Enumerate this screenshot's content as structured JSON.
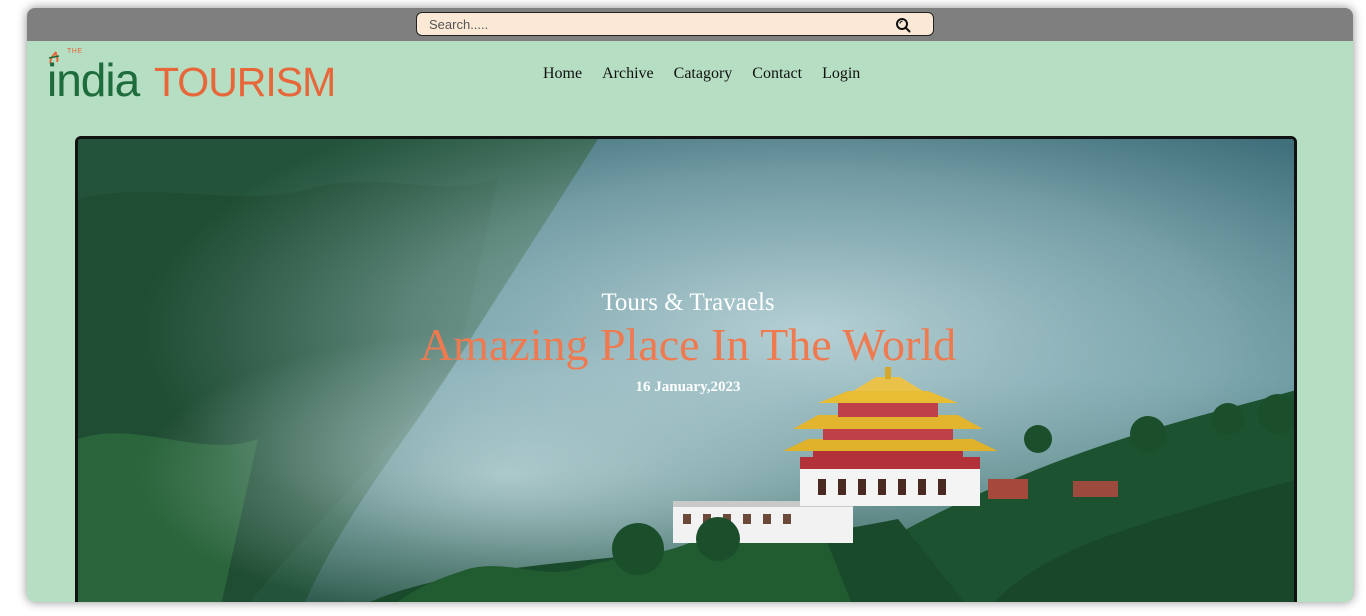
{
  "search": {
    "placeholder": "Search....."
  },
  "logo": {
    "the": "THE",
    "india": "india",
    "tourism": "TOURISM"
  },
  "nav": {
    "items": [
      "Home",
      "Archive",
      "Catagory",
      "Contact",
      "Login"
    ]
  },
  "hero": {
    "subtitle": "Tours & Travaels",
    "title": "Amazing Place In The World",
    "date": "16 January,2023"
  },
  "colors": {
    "page_bg": "#b5dec2",
    "topbar": "#7f7f7f",
    "search_bg": "#fbe9d6",
    "brand_green": "#1e6b3c",
    "brand_orange": "#e8673a",
    "hero_title": "#f07a4f"
  },
  "icons": {
    "search": "search-icon"
  }
}
